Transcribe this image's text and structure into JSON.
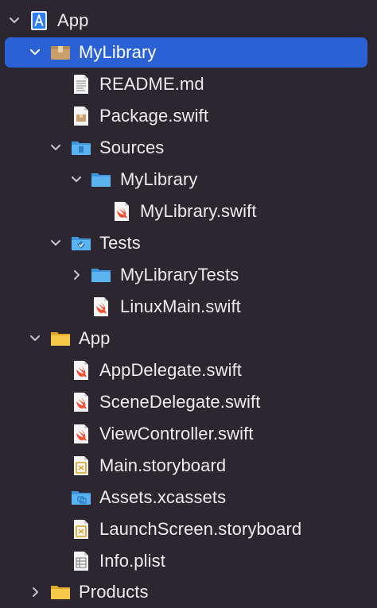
{
  "navigator": {
    "items": [
      {
        "label": "App",
        "icon": "xcode-project-icon",
        "disclosure": "expanded"
      },
      {
        "label": "MyLibrary",
        "icon": "package-icon",
        "disclosure": "expanded",
        "selected": true
      },
      {
        "label": "README.md",
        "icon": "text-document-icon",
        "disclosure": "none"
      },
      {
        "label": "Package.swift",
        "icon": "package-manifest-icon",
        "disclosure": "none"
      },
      {
        "label": "Sources",
        "icon": "sources-folder-icon",
        "disclosure": "expanded"
      },
      {
        "label": "MyLibrary",
        "icon": "folder-icon",
        "disclosure": "expanded"
      },
      {
        "label": "MyLibrary.swift",
        "icon": "swift-file-icon",
        "disclosure": "none"
      },
      {
        "label": "Tests",
        "icon": "tests-folder-icon",
        "disclosure": "expanded"
      },
      {
        "label": "MyLibraryTests",
        "icon": "folder-icon",
        "disclosure": "collapsed"
      },
      {
        "label": "LinuxMain.swift",
        "icon": "swift-file-icon",
        "disclosure": "none"
      },
      {
        "label": "App",
        "icon": "yellow-folder-icon",
        "disclosure": "expanded"
      },
      {
        "label": "AppDelegate.swift",
        "icon": "swift-file-icon",
        "disclosure": "none"
      },
      {
        "label": "SceneDelegate.swift",
        "icon": "swift-file-icon",
        "disclosure": "none"
      },
      {
        "label": "ViewController.swift",
        "icon": "swift-file-icon",
        "disclosure": "none"
      },
      {
        "label": "Main.storyboard",
        "icon": "storyboard-icon",
        "disclosure": "none"
      },
      {
        "label": "Assets.xcassets",
        "icon": "asset-catalog-icon",
        "disclosure": "none"
      },
      {
        "label": "LaunchScreen.storyboard",
        "icon": "storyboard-icon",
        "disclosure": "none"
      },
      {
        "label": "Info.plist",
        "icon": "plist-icon",
        "disclosure": "none"
      },
      {
        "label": "Products",
        "icon": "yellow-folder-icon",
        "disclosure": "collapsed"
      }
    ]
  },
  "colors": {
    "background": "#2b2630",
    "selection": "#2a62d6",
    "text": "#ececec",
    "swift": "#f05138",
    "folder_blue": "#5ab4f0",
    "folder_yellow": "#f7c948"
  }
}
